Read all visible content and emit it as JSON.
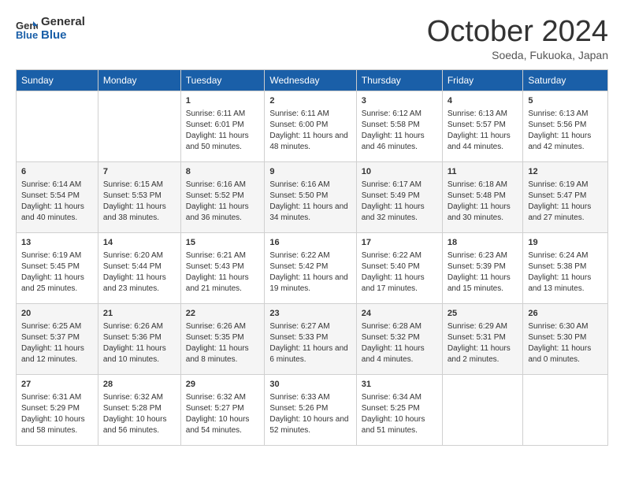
{
  "header": {
    "logo_line1": "General",
    "logo_line2": "Blue",
    "month": "October 2024",
    "location": "Soeda, Fukuoka, Japan"
  },
  "days_of_week": [
    "Sunday",
    "Monday",
    "Tuesday",
    "Wednesday",
    "Thursday",
    "Friday",
    "Saturday"
  ],
  "weeks": [
    [
      {
        "day": "",
        "info": ""
      },
      {
        "day": "",
        "info": ""
      },
      {
        "day": "1",
        "info": "Sunrise: 6:11 AM\nSunset: 6:01 PM\nDaylight: 11 hours and 50 minutes."
      },
      {
        "day": "2",
        "info": "Sunrise: 6:11 AM\nSunset: 6:00 PM\nDaylight: 11 hours and 48 minutes."
      },
      {
        "day": "3",
        "info": "Sunrise: 6:12 AM\nSunset: 5:58 PM\nDaylight: 11 hours and 46 minutes."
      },
      {
        "day": "4",
        "info": "Sunrise: 6:13 AM\nSunset: 5:57 PM\nDaylight: 11 hours and 44 minutes."
      },
      {
        "day": "5",
        "info": "Sunrise: 6:13 AM\nSunset: 5:56 PM\nDaylight: 11 hours and 42 minutes."
      }
    ],
    [
      {
        "day": "6",
        "info": "Sunrise: 6:14 AM\nSunset: 5:54 PM\nDaylight: 11 hours and 40 minutes."
      },
      {
        "day": "7",
        "info": "Sunrise: 6:15 AM\nSunset: 5:53 PM\nDaylight: 11 hours and 38 minutes."
      },
      {
        "day": "8",
        "info": "Sunrise: 6:16 AM\nSunset: 5:52 PM\nDaylight: 11 hours and 36 minutes."
      },
      {
        "day": "9",
        "info": "Sunrise: 6:16 AM\nSunset: 5:50 PM\nDaylight: 11 hours and 34 minutes."
      },
      {
        "day": "10",
        "info": "Sunrise: 6:17 AM\nSunset: 5:49 PM\nDaylight: 11 hours and 32 minutes."
      },
      {
        "day": "11",
        "info": "Sunrise: 6:18 AM\nSunset: 5:48 PM\nDaylight: 11 hours and 30 minutes."
      },
      {
        "day": "12",
        "info": "Sunrise: 6:19 AM\nSunset: 5:47 PM\nDaylight: 11 hours and 27 minutes."
      }
    ],
    [
      {
        "day": "13",
        "info": "Sunrise: 6:19 AM\nSunset: 5:45 PM\nDaylight: 11 hours and 25 minutes."
      },
      {
        "day": "14",
        "info": "Sunrise: 6:20 AM\nSunset: 5:44 PM\nDaylight: 11 hours and 23 minutes."
      },
      {
        "day": "15",
        "info": "Sunrise: 6:21 AM\nSunset: 5:43 PM\nDaylight: 11 hours and 21 minutes."
      },
      {
        "day": "16",
        "info": "Sunrise: 6:22 AM\nSunset: 5:42 PM\nDaylight: 11 hours and 19 minutes."
      },
      {
        "day": "17",
        "info": "Sunrise: 6:22 AM\nSunset: 5:40 PM\nDaylight: 11 hours and 17 minutes."
      },
      {
        "day": "18",
        "info": "Sunrise: 6:23 AM\nSunset: 5:39 PM\nDaylight: 11 hours and 15 minutes."
      },
      {
        "day": "19",
        "info": "Sunrise: 6:24 AM\nSunset: 5:38 PM\nDaylight: 11 hours and 13 minutes."
      }
    ],
    [
      {
        "day": "20",
        "info": "Sunrise: 6:25 AM\nSunset: 5:37 PM\nDaylight: 11 hours and 12 minutes."
      },
      {
        "day": "21",
        "info": "Sunrise: 6:26 AM\nSunset: 5:36 PM\nDaylight: 11 hours and 10 minutes."
      },
      {
        "day": "22",
        "info": "Sunrise: 6:26 AM\nSunset: 5:35 PM\nDaylight: 11 hours and 8 minutes."
      },
      {
        "day": "23",
        "info": "Sunrise: 6:27 AM\nSunset: 5:33 PM\nDaylight: 11 hours and 6 minutes."
      },
      {
        "day": "24",
        "info": "Sunrise: 6:28 AM\nSunset: 5:32 PM\nDaylight: 11 hours and 4 minutes."
      },
      {
        "day": "25",
        "info": "Sunrise: 6:29 AM\nSunset: 5:31 PM\nDaylight: 11 hours and 2 minutes."
      },
      {
        "day": "26",
        "info": "Sunrise: 6:30 AM\nSunset: 5:30 PM\nDaylight: 11 hours and 0 minutes."
      }
    ],
    [
      {
        "day": "27",
        "info": "Sunrise: 6:31 AM\nSunset: 5:29 PM\nDaylight: 10 hours and 58 minutes."
      },
      {
        "day": "28",
        "info": "Sunrise: 6:32 AM\nSunset: 5:28 PM\nDaylight: 10 hours and 56 minutes."
      },
      {
        "day": "29",
        "info": "Sunrise: 6:32 AM\nSunset: 5:27 PM\nDaylight: 10 hours and 54 minutes."
      },
      {
        "day": "30",
        "info": "Sunrise: 6:33 AM\nSunset: 5:26 PM\nDaylight: 10 hours and 52 minutes."
      },
      {
        "day": "31",
        "info": "Sunrise: 6:34 AM\nSunset: 5:25 PM\nDaylight: 10 hours and 51 minutes."
      },
      {
        "day": "",
        "info": ""
      },
      {
        "day": "",
        "info": ""
      }
    ]
  ]
}
